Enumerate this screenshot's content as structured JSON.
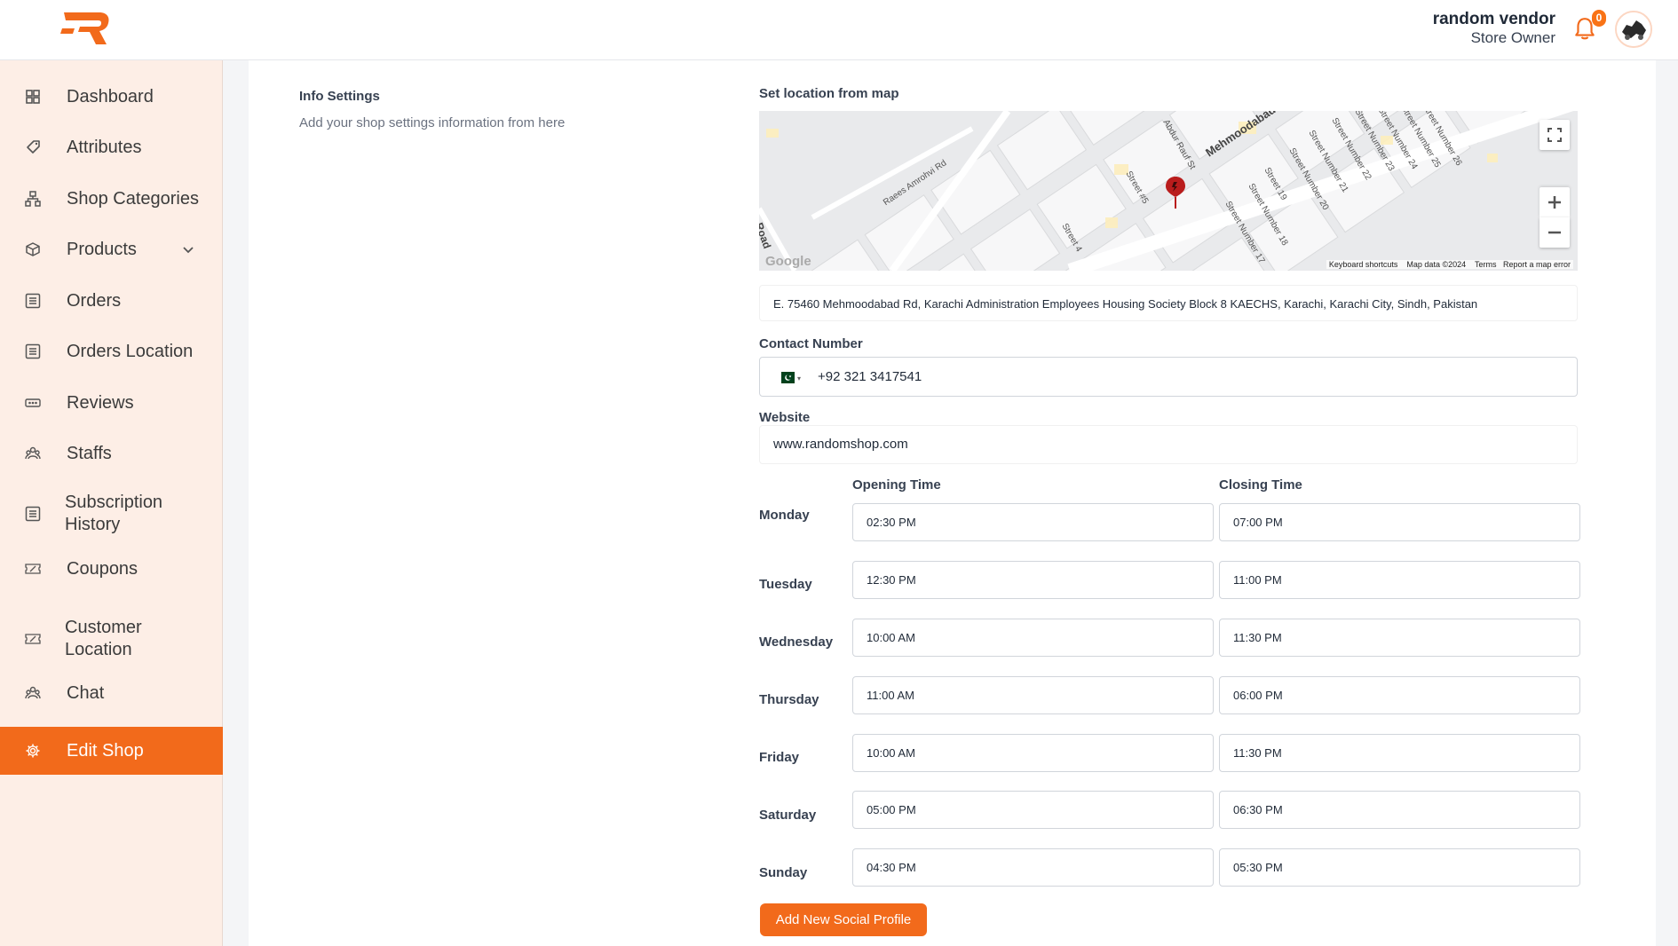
{
  "header": {
    "user_name": "random vendor",
    "user_role": "Store Owner",
    "notification_count": "0"
  },
  "sidebar": {
    "items": [
      {
        "label": "Dashboard",
        "icon": "dashboard-icon"
      },
      {
        "label": "Attributes",
        "icon": "tag-icon"
      },
      {
        "label": "Shop Categories",
        "icon": "sitemap-icon"
      },
      {
        "label": "Products",
        "icon": "box-icon"
      },
      {
        "label": "Orders",
        "icon": "list-icon"
      },
      {
        "label": "Orders Location",
        "icon": "list-icon"
      },
      {
        "label": "Reviews",
        "icon": "rating-icon"
      },
      {
        "label": "Staffs",
        "icon": "users-icon"
      },
      {
        "label": "Subscription History",
        "icon": "list-icon"
      },
      {
        "label": "Coupons",
        "icon": "coupon-icon"
      },
      {
        "label": "Customer Location",
        "icon": "coupon-icon"
      },
      {
        "label": "Chat",
        "icon": "users-icon"
      },
      {
        "label": "Edit Shop",
        "icon": "gear-icon"
      }
    ],
    "active": "Edit Shop"
  },
  "info": {
    "title": "Info Settings",
    "subtitle": "Add your shop settings information from here"
  },
  "map": {
    "label": "Set location from map",
    "streets": [
      "Mehmoodabad Rd",
      "Raees Amrohvi Rd",
      "Abdur Rauf St",
      "Street #5",
      "Street 4",
      "Street 19",
      "Street Number 17",
      "Street Number 18",
      "Street Number 20",
      "Street Number 21",
      "Street Number 22",
      "Street Number 23",
      "Street Number 24",
      "Street Number 25",
      "Street Number 26",
      "Road"
    ],
    "footer": [
      "Keyboard shortcuts",
      "Map data ©2024",
      "Terms",
      "Report a map error"
    ],
    "google": "Google"
  },
  "address": "E. 75460 Mehmoodabad Rd, Karachi Administration Employees Housing Society Block 8 KAECHS, Karachi, Karachi City, Sindh, Pakistan",
  "contact": {
    "label": "Contact Number",
    "value": "+92 321 3417541"
  },
  "website": {
    "label": "Website",
    "value": "www.randomshop.com"
  },
  "hours": {
    "opening_label": "Opening Time",
    "closing_label": "Closing Time",
    "days": [
      {
        "day": "Monday",
        "open": "02:30 PM",
        "close": "07:00 PM"
      },
      {
        "day": "Tuesday",
        "open": "12:30 PM",
        "close": "11:00 PM"
      },
      {
        "day": "Wednesday",
        "open": "10:00 AM",
        "close": "11:30 PM"
      },
      {
        "day": "Thursday",
        "open": "11:00 AM",
        "close": "06:00 PM"
      },
      {
        "day": "Friday",
        "open": "10:00 AM",
        "close": "11:30 PM"
      },
      {
        "day": "Saturday",
        "open": "05:00 PM",
        "close": "06:30 PM"
      },
      {
        "day": "Sunday",
        "open": "04:30 PM",
        "close": "05:30 PM"
      }
    ]
  },
  "social_button": "Add New Social Profile",
  "colors": {
    "accent": "#f26a1b",
    "sidebar_bg": "#fdeee6"
  }
}
